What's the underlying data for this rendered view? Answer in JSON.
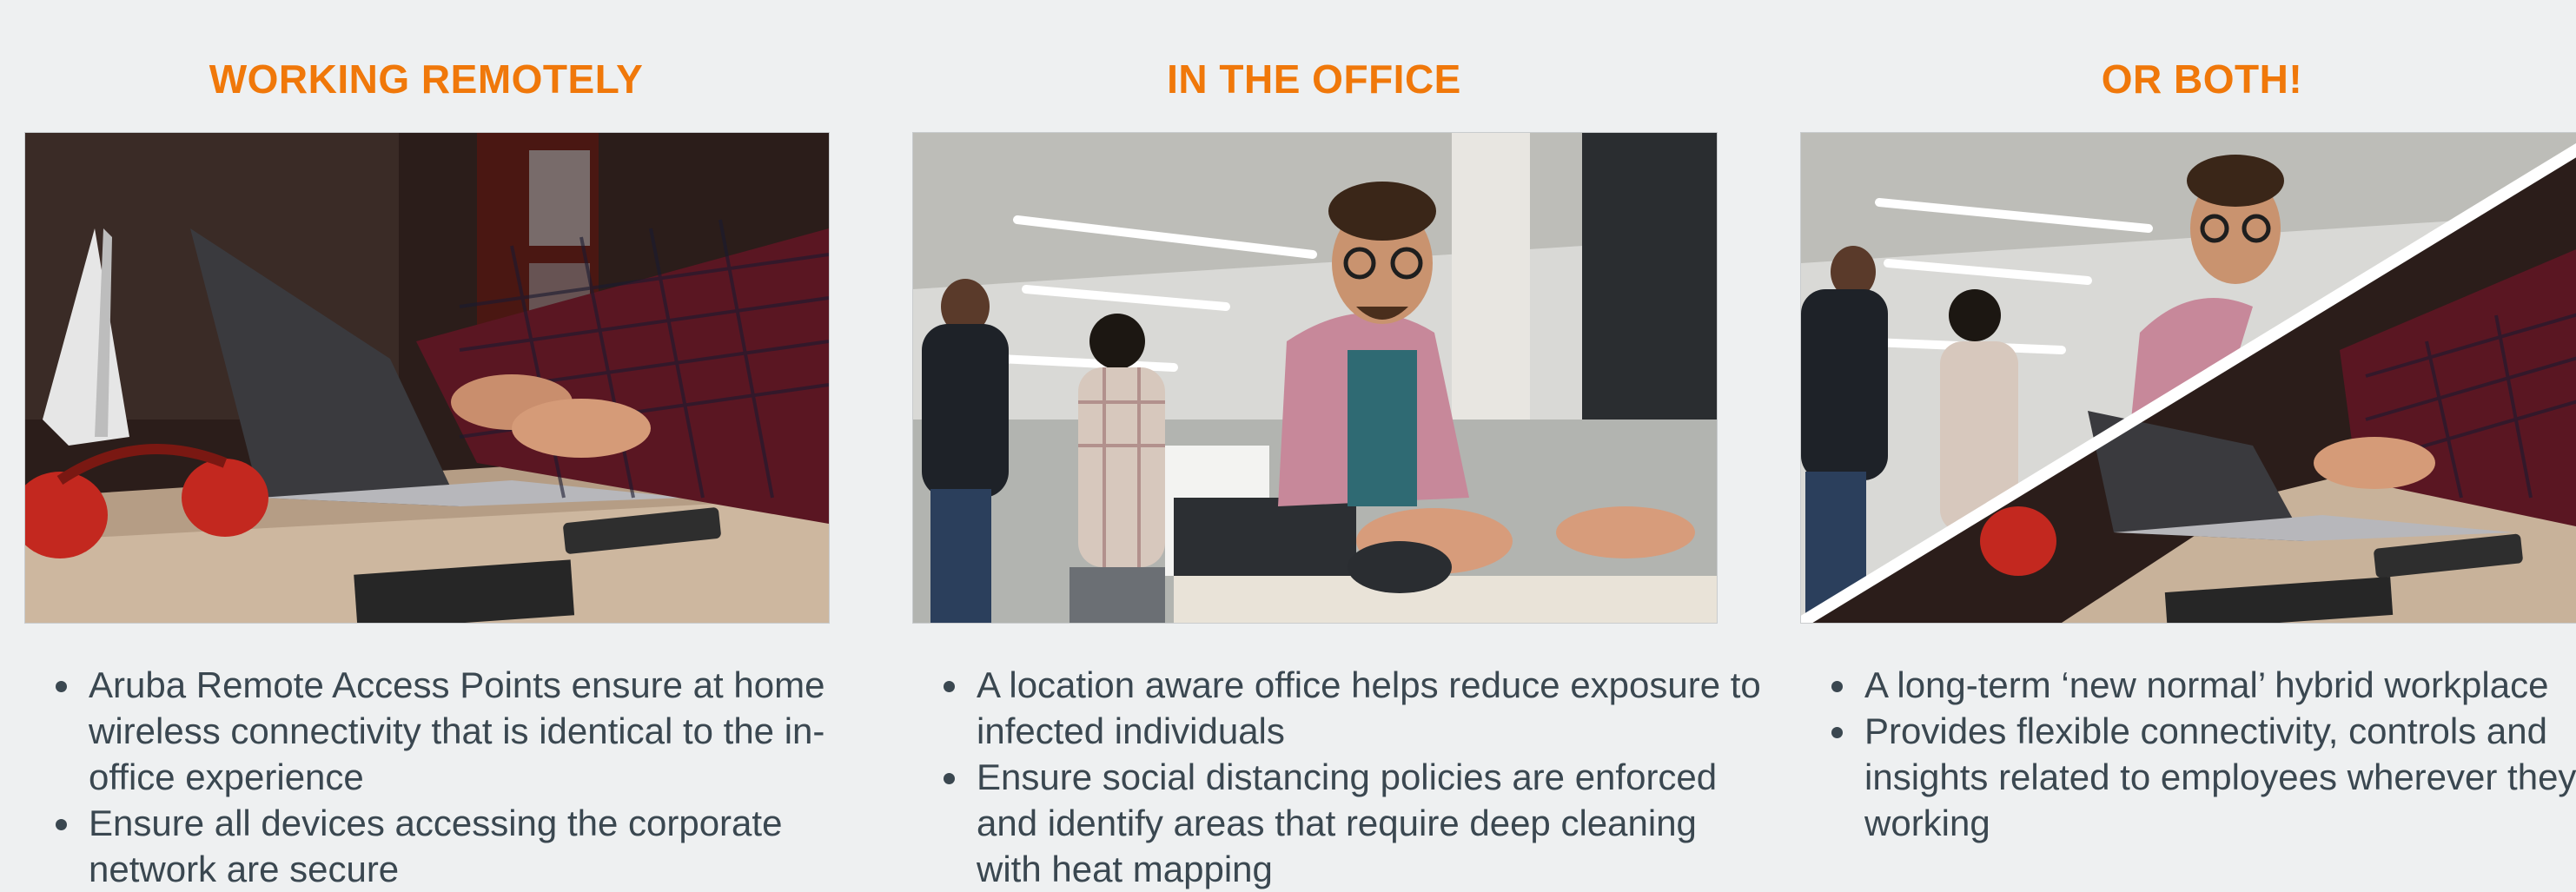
{
  "columns": [
    {
      "heading": "WORKING REMOTELY",
      "bullets": [
        "Aruba Remote Access Points ensure at home wireless connectivity that is identical to the in-office experience",
        "Ensure all devices accessing the corporate network are secure"
      ]
    },
    {
      "heading": "IN THE OFFICE",
      "bullets": [
        "A location aware office helps reduce exposure to infected individuals",
        "Ensure social distancing policies are enforced and identify areas that require deep cleaning with heat mapping"
      ]
    },
    {
      "heading": "OR BOTH!",
      "bullets": [
        "A long-term ‘new normal’ hybrid workplace",
        "Provides flexible connectivity, controls and insights related to employees wherever they are working"
      ]
    }
  ],
  "colors": {
    "heading": "#f0780a",
    "text": "#3a4750",
    "background": "#eef0f1"
  }
}
